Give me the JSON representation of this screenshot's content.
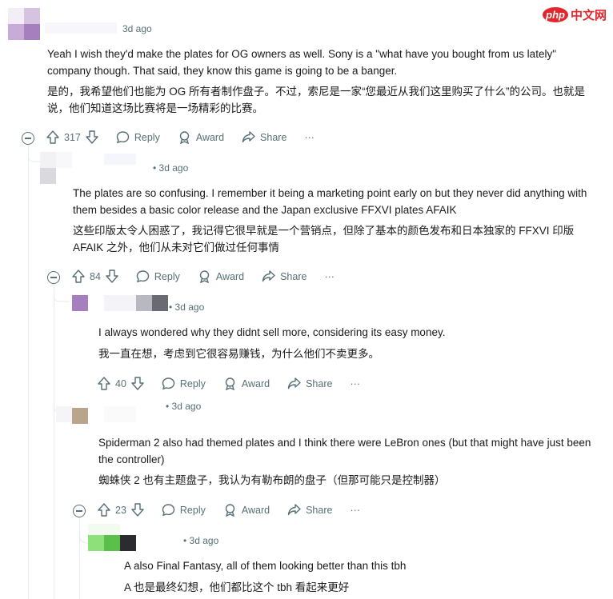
{
  "watermark": {
    "brand": "php",
    "site": "中文网"
  },
  "colors": {
    "text": "#1a1a1b",
    "meta": "#576f76",
    "thread_line": "#e5ebee",
    "brand": "#e3252c"
  },
  "comments": [
    {
      "time": "3d ago",
      "text": "Yeah I wish they'd make the plates for OG owners as well. Sony is a \"what have you bought from us lately\" company though. That said, they know this game is going to be a banger.",
      "translation": "是的，我希望他们也能为 OG 所有者制作盘子。不过，索尼是一家“您最近从我们这里购买了什么”的公司。也就是说，他们知道这场比赛将是一场精彩的比赛。",
      "score": "317"
    },
    {
      "time": "3d ago",
      "text": "The plates are so confusing. I remember it being a marketing point early on but they never did anything with them besides a basic color release and the Japan exclusive FFXVI plates AFAIK",
      "translation": "这些印版太令人困惑了，我记得它很早就是一个营销点，但除了基本的颜色发布和日本独家的 FFXVI 印版 AFAIK 之外，他们从未对它们做过任何事情",
      "score": "84"
    },
    {
      "time": "3d ago",
      "text": "I always wondered why they didnt sell more, considering its easy money.",
      "translation": "我一直在想，考虑到它很容易赚钱，为什么他们不卖更多。",
      "score": "40"
    },
    {
      "time": "3d ago",
      "text": "Spiderman 2 also had themed plates and I think there were LeBron ones (but that might have just been the controller)",
      "translation": "蜘蛛侠 2 也有主题盘子，我认为有勒布朗的盘子（但那可能只是控制器）",
      "score": "23"
    },
    {
      "time": "3d ago",
      "text": "A also Final Fantasy, all of them looking better than this tbh",
      "translation": "A 也是最终幻想，他们都比这个 tbh 看起来更好"
    }
  ],
  "actions": {
    "reply": "Reply",
    "award": "Award",
    "share": "Share",
    "more": "···"
  },
  "icons": [
    "upvote-icon",
    "downvote-icon",
    "reply-icon",
    "award-icon",
    "share-icon",
    "more-icon",
    "collapse-icon"
  ]
}
